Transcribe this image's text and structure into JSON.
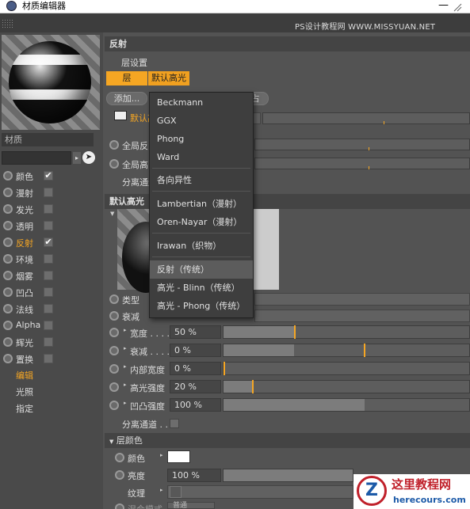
{
  "window": {
    "title": "材质编辑器",
    "min": "—"
  },
  "watermark": "PS设计教程网 WWW.MISSYUAN.NET",
  "material": {
    "label": "材质",
    "pick_icon": "arrow-cursor-icon"
  },
  "channels": [
    {
      "label": "颜色",
      "checked": true,
      "radio": true
    },
    {
      "label": "漫射",
      "checked": false,
      "radio": true
    },
    {
      "label": "发光",
      "checked": false,
      "radio": true
    },
    {
      "label": "透明",
      "checked": false,
      "radio": true
    },
    {
      "label": "反射",
      "checked": true,
      "radio": true,
      "active": true
    },
    {
      "label": "环境",
      "checked": false,
      "radio": true
    },
    {
      "label": "烟雾",
      "checked": false,
      "radio": true
    },
    {
      "label": "凹凸",
      "checked": false,
      "radio": true
    },
    {
      "label": "法线",
      "checked": false,
      "radio": true
    },
    {
      "label": "Alpha",
      "checked": false,
      "radio": true
    },
    {
      "label": "辉光",
      "checked": false,
      "radio": true
    },
    {
      "label": "置换",
      "checked": false,
      "radio": true
    }
  ],
  "sub": {
    "edit": "编辑",
    "light": "光照",
    "assign": "指定"
  },
  "reflect": {
    "header": "反射",
    "layer_settings": "层设置",
    "tab_layer": "层",
    "tab_default": "默认高光",
    "add": "添加...",
    "right_btn": "占",
    "layer_row_label": "默认高",
    "global_refl": "全局反",
    "global_spec": "全局高",
    "sep_channel": "分离通道"
  },
  "menu": {
    "items": [
      "Beckmann",
      "GGX",
      "Phong",
      "Ward",
      "各向异性",
      "Lambertian（漫射）",
      "Oren-Nayar（漫射）",
      "Irawan（织物）",
      "反射（传统）",
      "高光 - Blinn（传统）",
      "高光 - Phong（传统）"
    ],
    "selected": 8
  },
  "spec": {
    "header": "默认高光",
    "type": "类型",
    "attn": "衰减",
    "params": [
      {
        "label": "宽度 . . . .",
        "value": "50 %",
        "fraction": 0.5
      },
      {
        "label": "衰减 . . . .",
        "value": "0 %",
        "fraction": 0.5
      },
      {
        "label": "内部宽度",
        "value": "0 %",
        "fraction": 0.0
      },
      {
        "label": "高光强度",
        "value": "20 %",
        "fraction": 0.2
      },
      {
        "label": "凹凸强度",
        "value": "100 %",
        "fraction": 1.0
      }
    ],
    "sep_channel": "分离通道 . ."
  },
  "layer_color": {
    "header": "层颜色",
    "color_label": "颜色",
    "brightness_label": "亮度",
    "brightness_value": "100 %",
    "texture_label": "纹理",
    "mix_label": "混合模式 . . . .",
    "mix_value": "普通",
    "swatch": "#ffffff"
  },
  "logo": {
    "title": "这里教程网",
    "url": "herecours.com",
    "mark": "Z"
  },
  "colors": {
    "accent": "#f5a623",
    "panel": "#535353"
  }
}
